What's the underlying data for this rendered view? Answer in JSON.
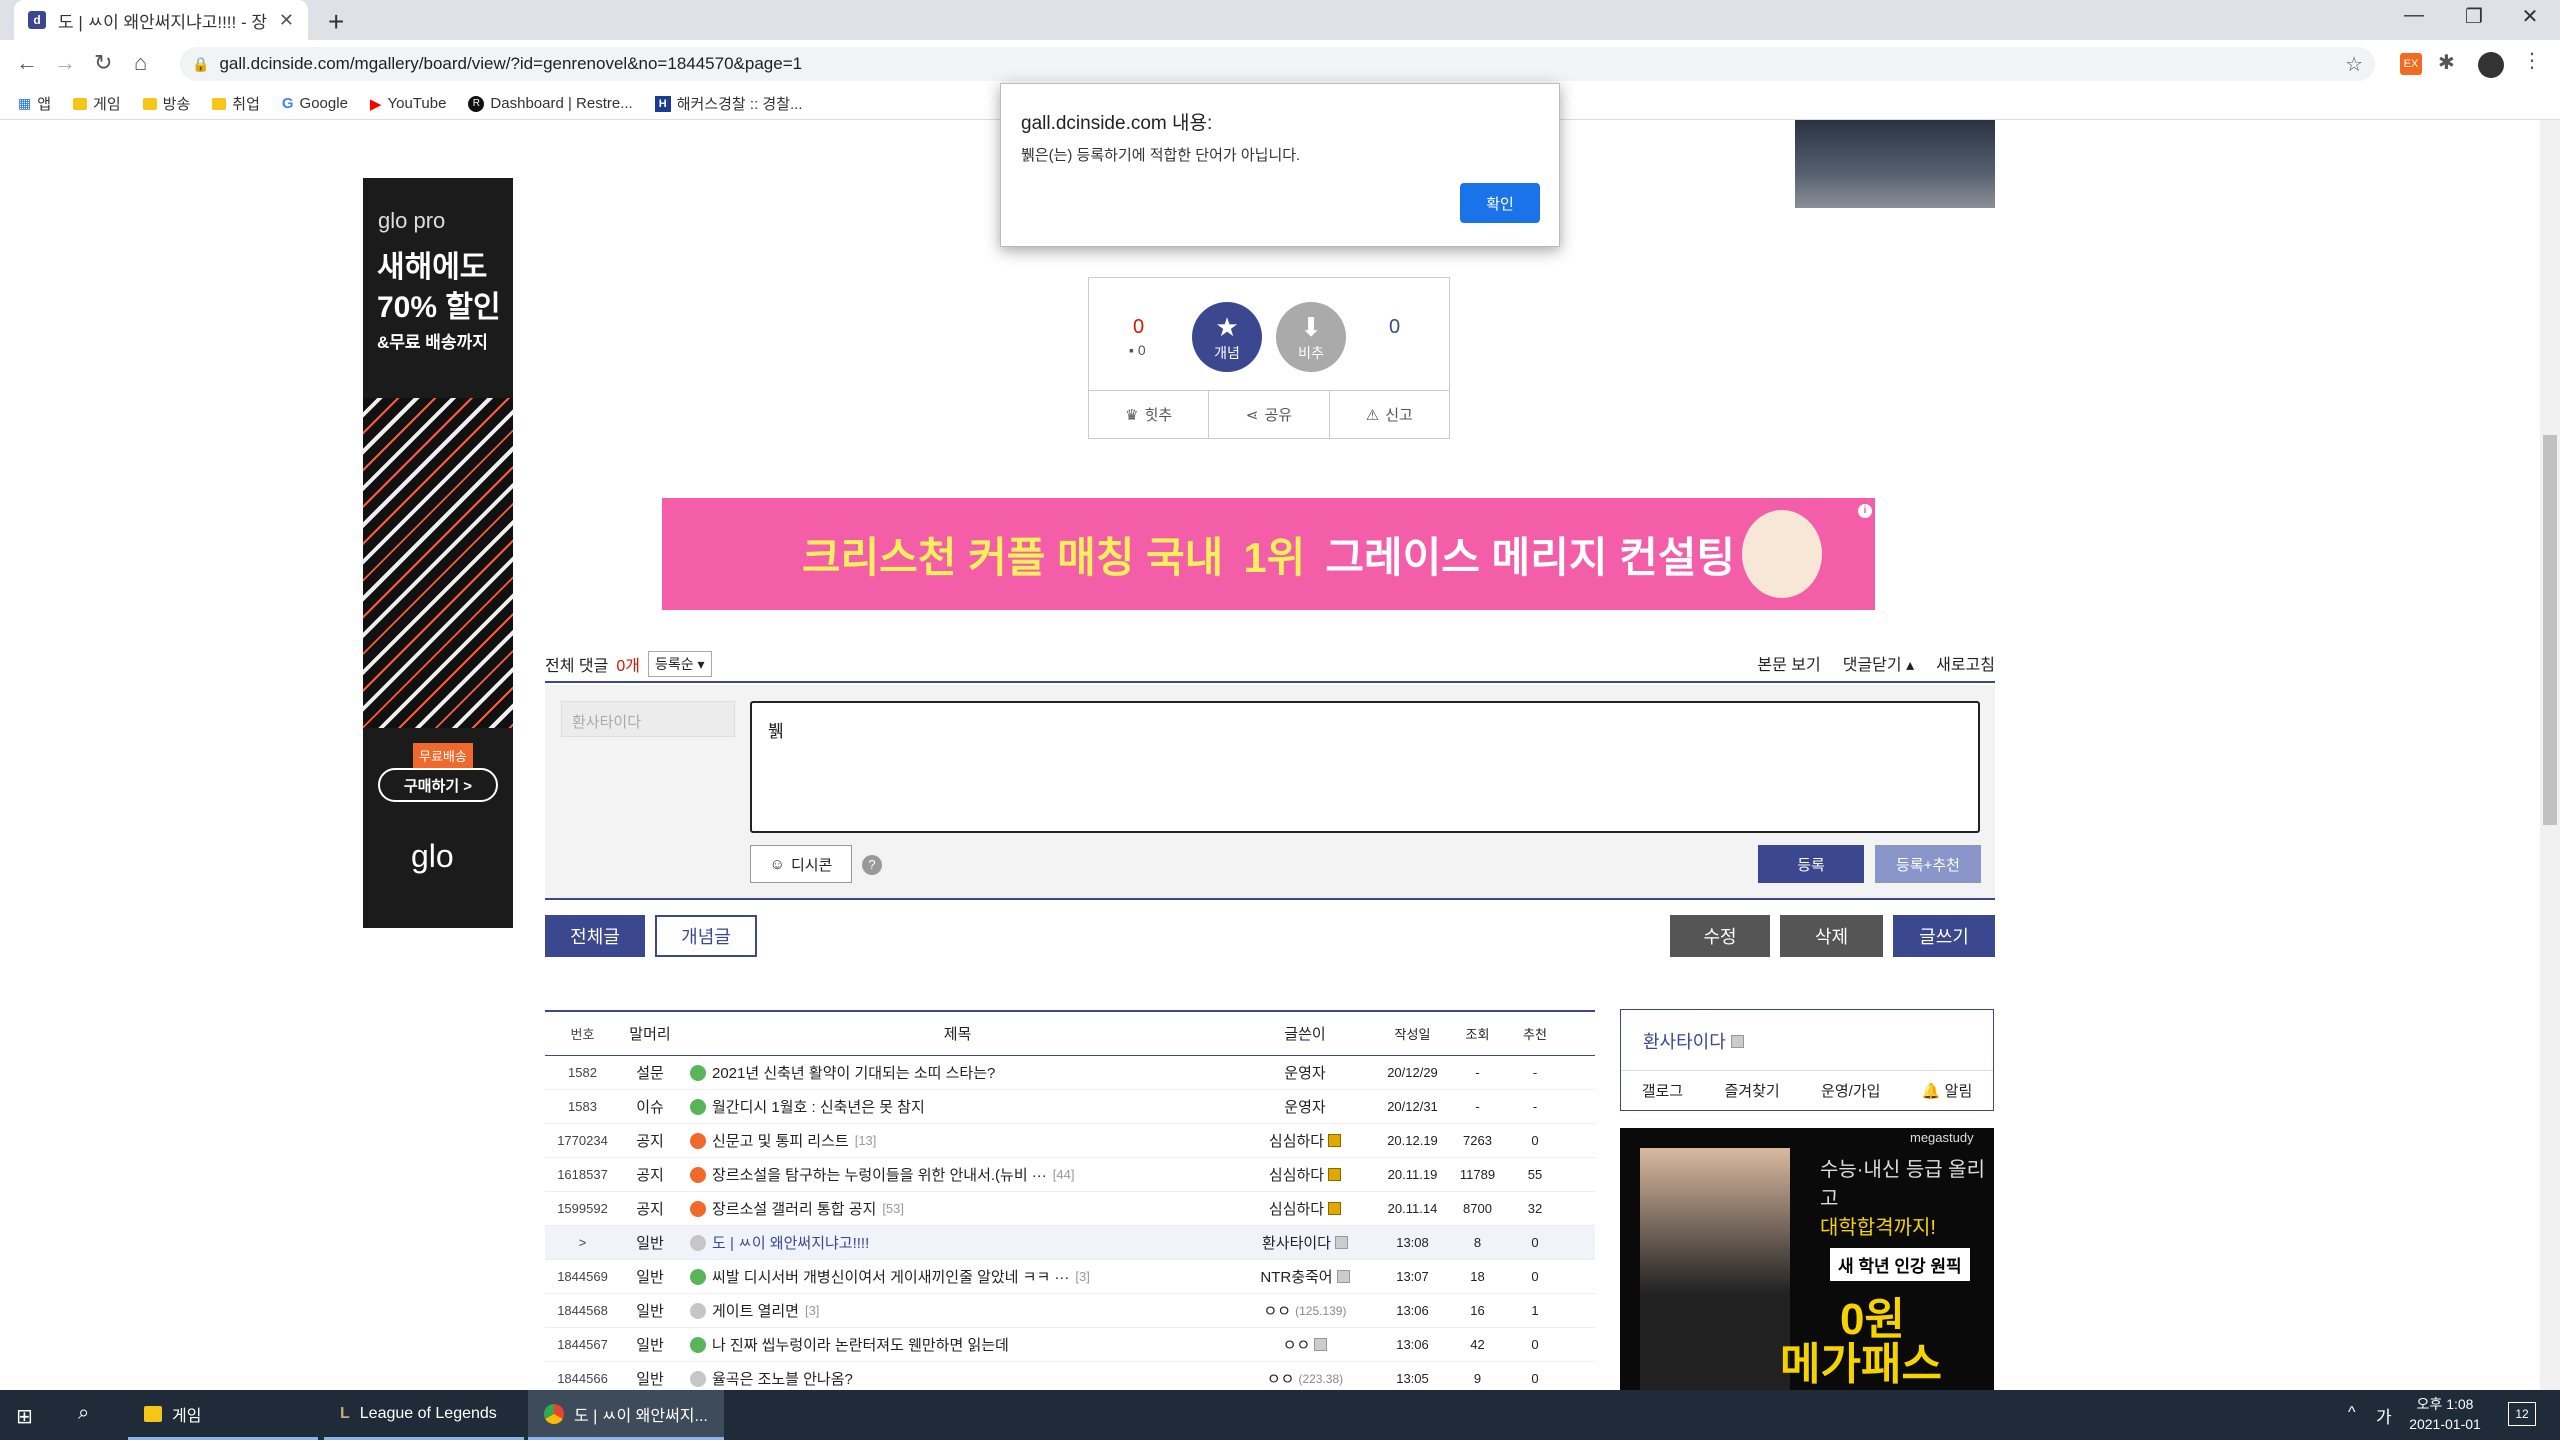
{
  "browser": {
    "tab_title": "도 | ㅆ이 왜안써지냐고!!!! - 장트",
    "tab_favicon": "dc",
    "url": "gall.dcinside.com/mgallery/board/view/?id=genrenovel&no=1844570&page=1",
    "bookmarks": [
      "앱",
      "게임",
      "방송",
      "취업",
      "Google",
      "YouTube",
      "Dashboard | Restre...",
      "해커스경찰 :: 경찰..."
    ]
  },
  "ad_left": {
    "brand": "glo pro",
    "headline1": "새해에도",
    "headline2": "70% 할인",
    "headline3": "&무료 배송까지",
    "badge": "무료배송",
    "cta": "구매하기 >",
    "logo": "glo"
  },
  "recommend": {
    "up_count": "0",
    "fixed_count": "0",
    "up_label": "개념",
    "down_label": "비추",
    "down_count": "0",
    "hit_label": "힛추",
    "share_label": "공유",
    "report_label": "신고"
  },
  "banner": {
    "text1": "크리스천 커플 매칭 국내",
    "text2": "1위",
    "text3": "그레이스 메리지 컨설팅"
  },
  "comments": {
    "total_label": "전체 댓글",
    "count": "0개",
    "sort": "등록순",
    "view_post": "본문 보기",
    "close_comments": "댓글닫기",
    "refresh": "새로고침",
    "nick_placeholder": "환사타이다",
    "text_value": "뷁",
    "dccon": "디시콘",
    "help": "?",
    "submit": "등록",
    "submit_recommend": "등록+추천"
  },
  "buttons": {
    "all": "전체글",
    "concept": "개념글",
    "edit": "수정",
    "delete": "삭제",
    "write": "글쓰기"
  },
  "list": {
    "headers": [
      "번호",
      "말머리",
      "제목",
      "글쓴이",
      "작성일",
      "조회",
      "추천"
    ],
    "rows": [
      {
        "no": "1582",
        "head": "설문",
        "icon": "green",
        "title": "2021년 신축년 활약이 기대되는 소띠 스타는?",
        "reply": "",
        "writer": "운영자",
        "badge": "",
        "date": "20/12/29",
        "views": "-",
        "rec": "-"
      },
      {
        "no": "1583",
        "head": "이슈",
        "icon": "green",
        "title": "월간디시 1월호 : 신축년은 못 참지",
        "reply": "",
        "writer": "운영자",
        "badge": "",
        "date": "20/12/31",
        "views": "-",
        "rec": "-"
      },
      {
        "no": "1770234",
        "head": "공지",
        "icon": "orange",
        "title": "신문고 및 통피 리스트",
        "reply": "[13]",
        "writer": "심심하다",
        "badge": "gold",
        "date": "20.12.19",
        "views": "7263",
        "rec": "0"
      },
      {
        "no": "1618537",
        "head": "공지",
        "icon": "orange",
        "title": "장르소설을 탐구하는 누렁이들을 위한 안내서.(뉴비 ···",
        "reply": "[44]",
        "writer": "심심하다",
        "badge": "gold",
        "date": "20.11.19",
        "views": "11789",
        "rec": "55"
      },
      {
        "no": "1599592",
        "head": "공지",
        "icon": "orange",
        "title": "장르소설 갤러리 통합 공지",
        "reply": "[53]",
        "writer": "심심하다",
        "badge": "gold",
        "date": "20.11.14",
        "views": "8700",
        "rec": "32"
      },
      {
        "no": ">",
        "head": "일반",
        "icon": "gray",
        "title": "도 | ㅆ이 왜안써지냐고!!!!",
        "reply": "",
        "writer": "환사타이다",
        "badge": "gray",
        "date": "13:08",
        "views": "8",
        "rec": "0",
        "current": true
      },
      {
        "no": "1844569",
        "head": "일반",
        "icon": "green",
        "title": "씨발 디시서버 개병신이여서 게이새끼인줄 알았네 ㅋㅋ ···",
        "reply": "[3]",
        "writer": "NTR충죽어",
        "badge": "gray",
        "date": "13:07",
        "views": "18",
        "rec": "0"
      },
      {
        "no": "1844568",
        "head": "일반",
        "icon": "gray",
        "title": "게이트 열리면",
        "reply": "[3]",
        "writer": "ㅇㅇ",
        "ip": "(125.139)",
        "badge": "",
        "date": "13:06",
        "views": "16",
        "rec": "1"
      },
      {
        "no": "1844567",
        "head": "일반",
        "icon": "green",
        "title": "나 진짜 씹누렁이라 논란터져도 웬만하면 읽는데",
        "reply": "",
        "writer": "ㅇㅇ",
        "badge": "gray",
        "date": "13:06",
        "views": "42",
        "rec": "0"
      },
      {
        "no": "1844566",
        "head": "일반",
        "icon": "gray",
        "title": "율곡은 조노블 안나옴?",
        "reply": "",
        "writer": "ㅇㅇ",
        "ip": "(223.38)",
        "badge": "",
        "date": "13:05",
        "views": "9",
        "rec": "0"
      }
    ]
  },
  "userbox": {
    "nick": "환사타이다",
    "links": [
      "갤로그",
      "즐겨찾기",
      "운영/가입",
      "알림"
    ]
  },
  "ad_right": {
    "brand": "megastudy",
    "line1": "수능·내신 등급 올리고",
    "line2": "대학합격까지!",
    "line3": "새 학년 인강 원픽",
    "line4": "0원",
    "line5": "메가패스"
  },
  "dialog": {
    "header": "gall.dcinside.com 내용:",
    "message": "뷁은(는) 등록하기에 적합한 단어가 아닙니다.",
    "ok": "확인"
  },
  "taskbar": {
    "items": [
      "게임",
      "League of Legends",
      "도 | ㅆ이 왜안써지..."
    ],
    "ime": "가",
    "time": "오후 1:08",
    "date": "2021-01-01",
    "notif": "12"
  },
  "colors": {
    "accent": "#3b4890",
    "red": "#d31900",
    "dialog_ok": "#1a73e8"
  }
}
